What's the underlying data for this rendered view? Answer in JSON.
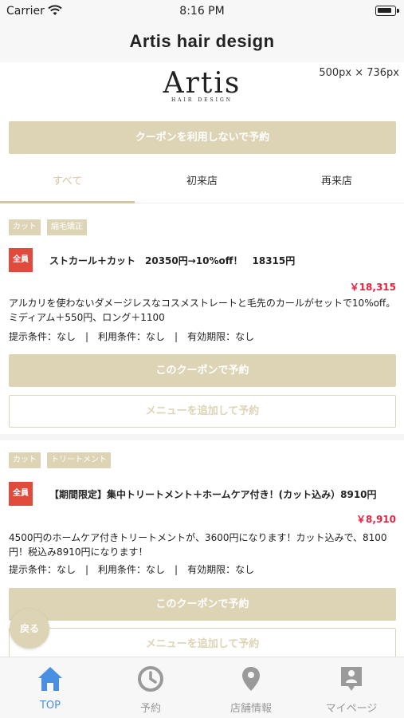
{
  "status_bar": {
    "carrier": "Carrier",
    "time": "8:16 PM"
  },
  "navbar": {
    "title": "Artis hair design"
  },
  "header": {
    "dimension_note": "500px × 736px",
    "logo_word": "Artis",
    "logo_sub": "HAIR DESIGN"
  },
  "no_coupon_button": "クーポンを利用しないで予約",
  "tabs": [
    {
      "label": "すべて",
      "active": true
    },
    {
      "label": "初来店",
      "active": false
    },
    {
      "label": "再来店",
      "active": false
    }
  ],
  "coupons": [
    {
      "tags": [
        "カット",
        "縮毛矯正"
      ],
      "badge": "全員",
      "title": "ストカール＋カット　20350円→10%off！　18315円",
      "price": "￥18,315",
      "description": "アルカリを使わないダメージレスなコスメストレートと毛先のカールがセットで10%off。ミディアム＋550円、ロング＋1100",
      "conditions": "提示条件：なし　|　利用条件：なし　|　有効期限：なし",
      "reserve_label": "このクーポンで予約",
      "add_menu_label": "メニューを追加して予約"
    },
    {
      "tags": [
        "カット",
        "トリートメント"
      ],
      "badge": "全員",
      "title": "【期間限定】集中トリートメント＋ホームケア付き！(カット込み）8910円",
      "price": "￥8,910",
      "description": "4500円のホームケア付きトリートメントが、3600円になります！カット込みで、8100円！税込み8910円になります！",
      "conditions": "提示条件：なし　|　利用条件：なし　|　有効期限：なし",
      "reserve_label": "このクーポンで予約",
      "add_menu_label": "メニューを追加して予約"
    }
  ],
  "back_button": "戻る",
  "bottom_tabs": [
    {
      "label": "TOP",
      "icon": "home-icon",
      "active": true
    },
    {
      "label": "予約",
      "icon": "clock-icon",
      "active": false
    },
    {
      "label": "店舗情報",
      "icon": "location-pin-icon",
      "active": false
    },
    {
      "label": "マイページ",
      "icon": "profile-icon",
      "active": false
    }
  ],
  "colors": {
    "accent": "#ddd4b6",
    "badge_red": "#e24a3b",
    "price_red": "#e5243f",
    "active_tab_blue": "#4a90e2"
  }
}
